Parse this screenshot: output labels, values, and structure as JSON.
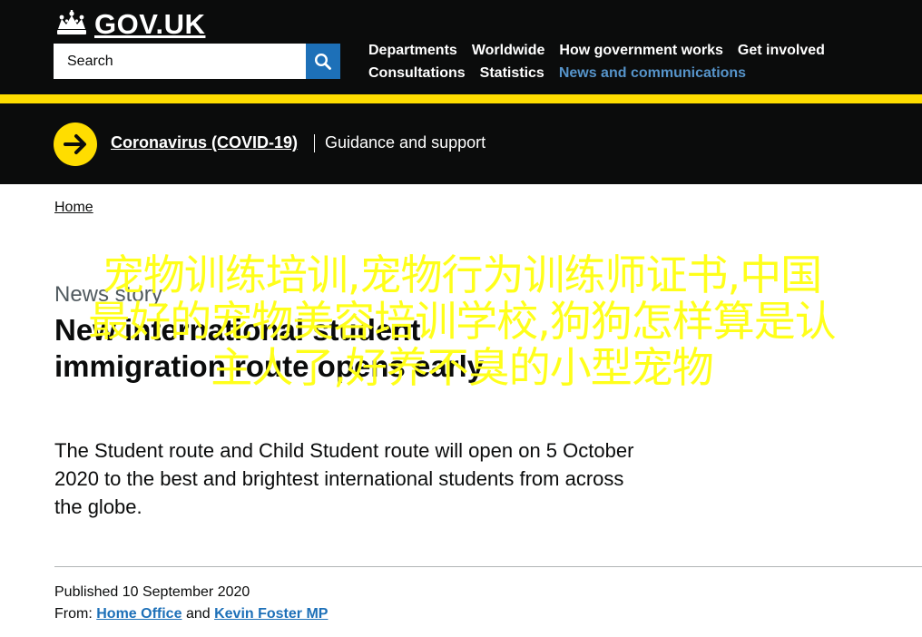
{
  "header": {
    "logo_text": "GOV.UK",
    "search": {
      "placeholder": "Search"
    },
    "nav": [
      {
        "label": "Departments",
        "active": false
      },
      {
        "label": "Worldwide",
        "active": false
      },
      {
        "label": "How government works",
        "active": false
      },
      {
        "label": "Get involved",
        "active": false
      },
      {
        "label": "Consultations",
        "active": false
      },
      {
        "label": "Statistics",
        "active": false
      },
      {
        "label": "News and communications",
        "active": true
      }
    ]
  },
  "covid_banner": {
    "link_label": "Coronavirus (COVID-19)",
    "guidance_label": "Guidance and support"
  },
  "breadcrumb": {
    "home_label": "Home"
  },
  "article": {
    "kicker": "News story",
    "title": "New international student immigration route opens early",
    "lead": "The Student route and Child Student route will open on 5 October 2020 to the best and brightest international students from across the globe.",
    "published_label": "Published",
    "published_date": "10 September 2020",
    "from_label": "From:",
    "from_org_1": "Home Office",
    "from_joiner": "and",
    "from_org_2": "Kevin Foster MP"
  },
  "overlay": {
    "line_1": "宠物训练培训,宠物行为训练师证书,中国",
    "line_2": "最好的宠物美容培训学校,狗狗怎样算是认",
    "line_3": "主人了,好养不臭的小型宠物"
  },
  "colors": {
    "header_bg": "#0b0c0c",
    "brand_yellow": "#ffdd00",
    "link_blue": "#1d70b8",
    "active_nav": "#5694ca",
    "overlay_yellow": "#ffff1a"
  },
  "icons": {
    "logo": "crown-icon",
    "search": "magnifier-icon",
    "covid": "arrow-right-circle-icon"
  }
}
